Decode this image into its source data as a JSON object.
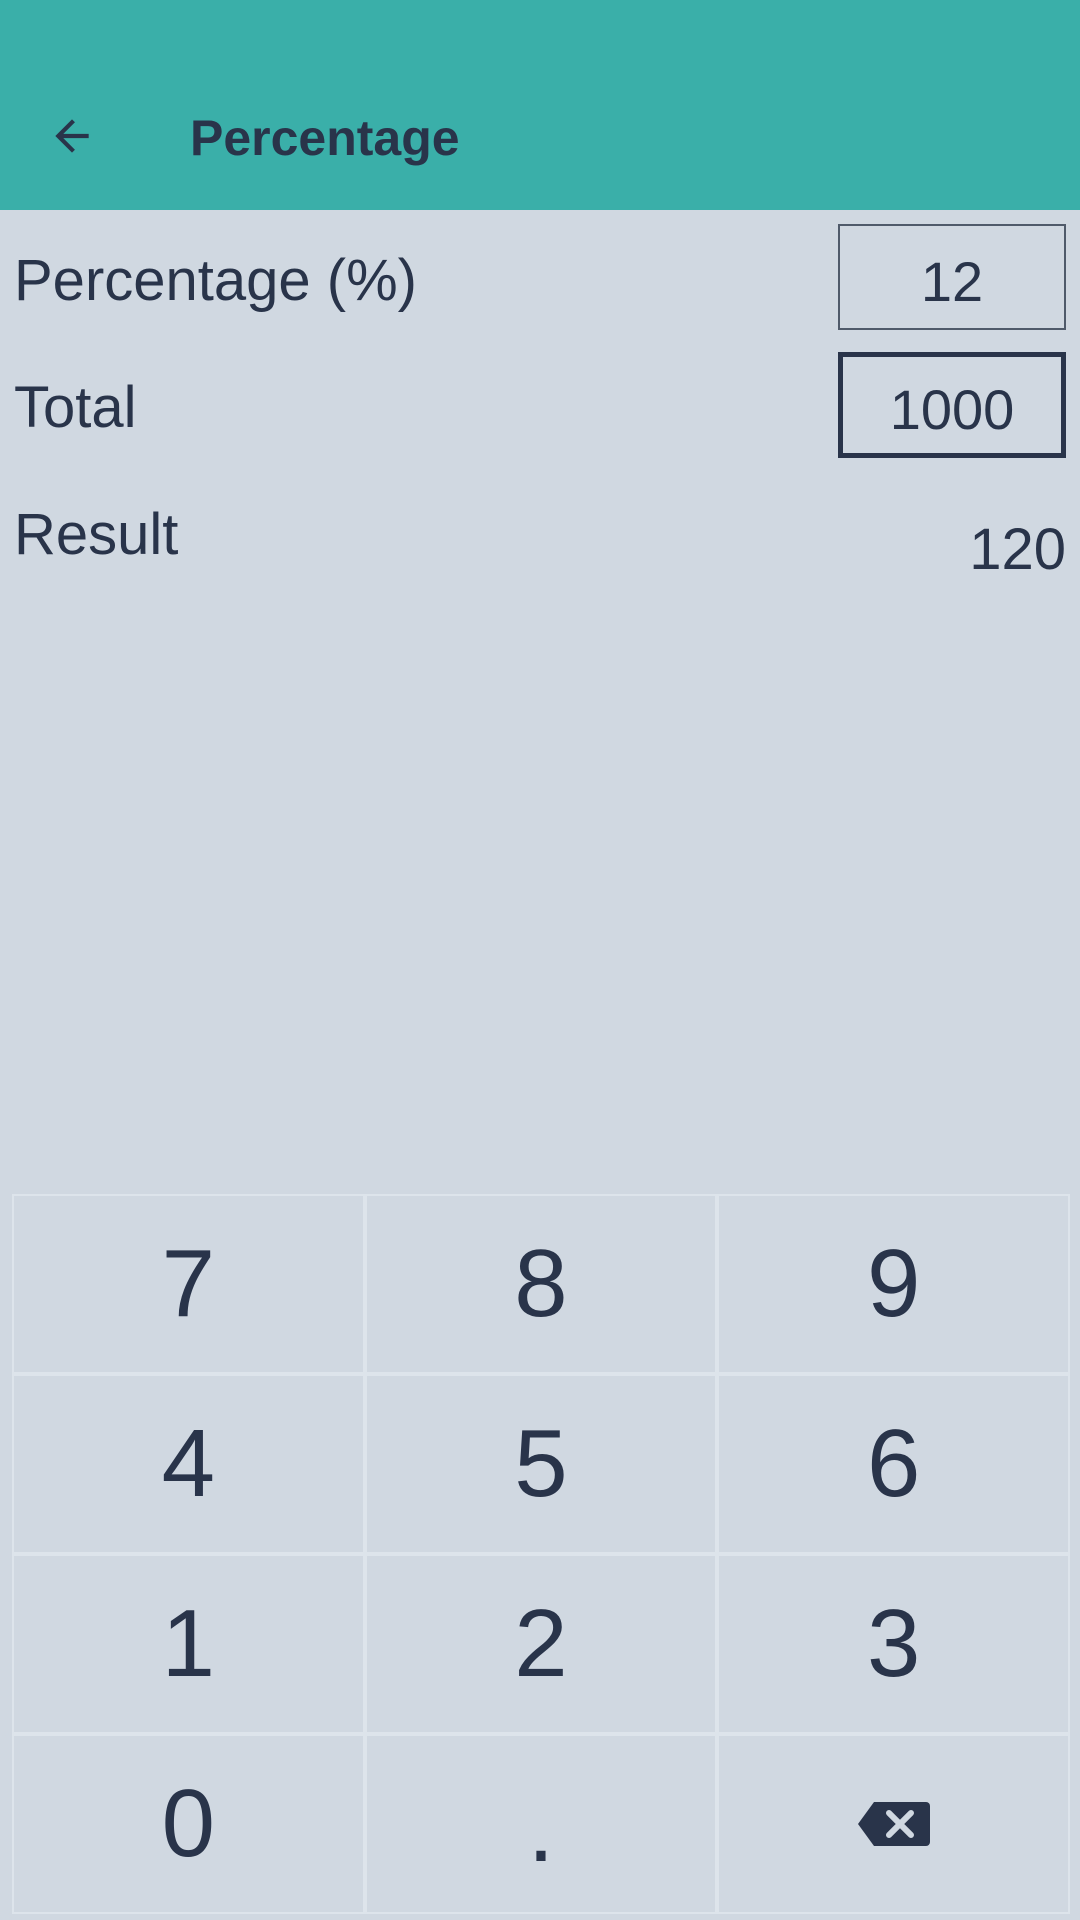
{
  "appbar": {
    "title": "Percentage",
    "back_icon": "arrow-left-icon"
  },
  "form": {
    "percentage_label": "Percentage (%)",
    "percentage_value": "12",
    "total_label": "Total",
    "total_value": "1000",
    "result_label": "Result",
    "result_value": "120"
  },
  "keypad": {
    "keys": [
      "7",
      "8",
      "9",
      "4",
      "5",
      "6",
      "1",
      "2",
      "3",
      "0",
      ".",
      ""
    ],
    "backspace_icon": "backspace-icon"
  },
  "colors": {
    "appbar_bg": "#3aafa9",
    "background": "#d0d8e1",
    "text": "#29344a"
  }
}
